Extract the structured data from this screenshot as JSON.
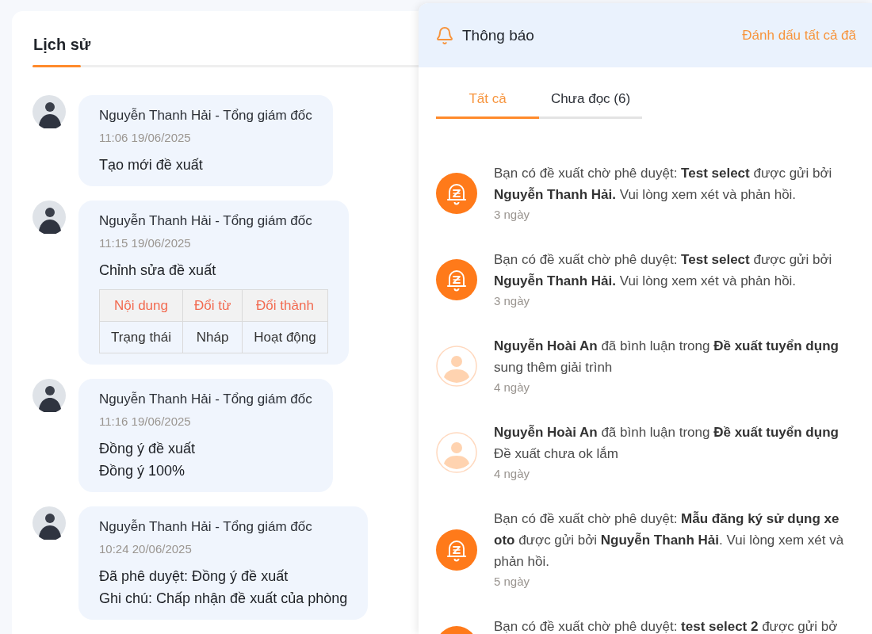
{
  "history": {
    "tabs": [
      {
        "label": "Lịch sử",
        "selected": true
      }
    ],
    "entries": [
      {
        "author": "Nguyễn Thanh Hải - Tổng giám đốc",
        "time": "11:06 19/06/2025",
        "lines": [
          "Tạo mới đề xuất"
        ]
      },
      {
        "author": "Nguyễn Thanh Hải - Tổng giám đốc",
        "time": "11:15 19/06/2025",
        "lines": [
          "Chỉnh sửa đề xuất"
        ],
        "changes": {
          "columns": [
            "Nội dung",
            "Đổi từ",
            "Đổi thành"
          ],
          "rows": [
            [
              "Trạng thái",
              "Nháp",
              "Hoạt động"
            ]
          ]
        }
      },
      {
        "author": "Nguyễn Thanh Hải - Tổng giám đốc",
        "time": "11:16 19/06/2025",
        "lines": [
          "Đồng ý đề xuất",
          "Đồng ý 100%"
        ]
      },
      {
        "author": "Nguyễn Thanh Hải - Tổng giám đốc",
        "time": "10:24 20/06/2025",
        "lines": [
          "Đã phê duyệt: Đồng ý đề xuất",
          "Ghi chú: Chấp nhận đề xuất của phòng"
        ]
      }
    ]
  },
  "notifications": {
    "title": "Thông báo",
    "mark_all": "Đánh dấu tất cả đã",
    "tabs": [
      {
        "label": "Tất cả",
        "selected": true
      },
      {
        "label": "Chưa đọc (6)",
        "selected": false
      }
    ],
    "items": [
      {
        "kind": "approval",
        "lines": [
          "Bạn có đề xuất chờ phê duyệt: **Test select** được gửi bởi",
          "**Nguyễn Thanh Hải.** Vui lòng xem xét và phản hồi."
        ],
        "time": "3 ngày"
      },
      {
        "kind": "approval",
        "lines": [
          "Bạn có đề xuất chờ phê duyệt: **Test select** được gửi bởi",
          "**Nguyễn Thanh Hải.** Vui lòng xem xét và phản hồi."
        ],
        "time": "3 ngày"
      },
      {
        "kind": "comment",
        "lines": [
          "**Nguyễn Hoài An** đã bình luận trong **Đề xuất tuyển dụng**",
          "sung thêm giải trình"
        ],
        "time": "4 ngày"
      },
      {
        "kind": "comment",
        "lines": [
          "**Nguyễn Hoài An** đã bình luận trong **Đề xuất tuyển dụng**",
          "Đề xuất chưa ok lắm"
        ],
        "time": "4 ngày"
      },
      {
        "kind": "approval",
        "lines": [
          "Bạn có đề xuất chờ phê duyệt: **Mẫu đăng ký sử dụng xe**",
          "**oto** được gửi bởi **Nguyễn Thanh Hải**. Vui lòng xem xét và",
          "phản hồi."
        ],
        "time": "5 ngày"
      },
      {
        "kind": "approval",
        "lines": [
          "Bạn có đề xuất chờ phê duyệt: **test select 2** được gửi bở"
        ]
      }
    ]
  }
}
